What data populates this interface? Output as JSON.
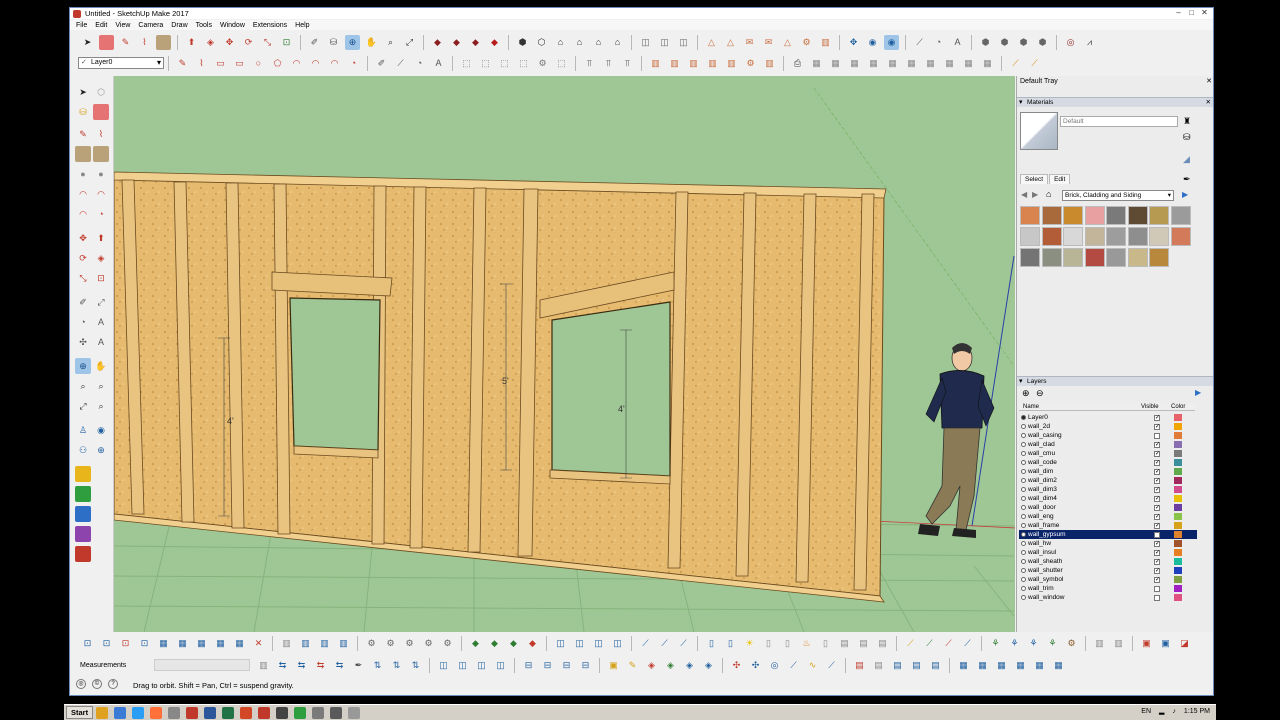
{
  "window": {
    "title": "Untitled - SketchUp Make 2017"
  },
  "window_controls": {
    "minimize": "–",
    "maximize": "□",
    "close": "✕"
  },
  "menu": [
    "File",
    "Edit",
    "View",
    "Camera",
    "Draw",
    "Tools",
    "Window",
    "Extensions",
    "Help"
  ],
  "layers_toolbar": {
    "current_layer": "Layer0"
  },
  "tray": {
    "title": "Default Tray",
    "materials": {
      "header": "Materials",
      "current_material": "Default",
      "tabs": [
        "Select",
        "Edit"
      ],
      "collection": "Brick, Cladding and Siding",
      "swatch_colors": [
        "#d9844e",
        "#a86a3a",
        "#c98a2e",
        "#e9a0a0",
        "#7a7a7a",
        "#5f4a34",
        "#b79a52",
        "#9b9b9b",
        "#c7c7c7",
        "#b35c38",
        "#d8d8d8",
        "#c2b59a",
        "#9d9d9d",
        "#8e8e8e",
        "#d1c9b8",
        "#d27a5a",
        "#747474",
        "#8b8f82",
        "#b8b496",
        "#b34b42",
        "#999999",
        "#c9b98a",
        "#b8893c"
      ]
    },
    "layers": {
      "header": "Layers",
      "columns": {
        "name": "Name",
        "visible": "Visible",
        "color": "Color"
      },
      "rows": [
        {
          "name": "Layer0",
          "active": true,
          "visible": true,
          "color": "#e8626a"
        },
        {
          "name": "wall_2d",
          "visible": true,
          "color": "#f0a500"
        },
        {
          "name": "wall_casing",
          "visible": false,
          "color": "#e07b39"
        },
        {
          "name": "wall_clad",
          "visible": true,
          "color": "#8a6fb0"
        },
        {
          "name": "wall_cmu",
          "visible": true,
          "color": "#7a7a7a"
        },
        {
          "name": "wall_code",
          "visible": true,
          "color": "#3a8f9a"
        },
        {
          "name": "wall_dim",
          "visible": true,
          "color": "#5fa84b"
        },
        {
          "name": "wall_dim2",
          "visible": true,
          "color": "#a1285c"
        },
        {
          "name": "wall_dim3",
          "visible": true,
          "color": "#d14c8a"
        },
        {
          "name": "wall_dim4",
          "visible": true,
          "color": "#e8c000"
        },
        {
          "name": "wall_door",
          "visible": true,
          "color": "#6b3fa0"
        },
        {
          "name": "wall_eng",
          "visible": true,
          "color": "#8bc34a"
        },
        {
          "name": "wall_frame",
          "visible": true,
          "color": "#d6a21a"
        },
        {
          "name": "wall_gypsum",
          "visible": false,
          "color": "#e0822d",
          "selected": true
        },
        {
          "name": "wall_hw",
          "visible": true,
          "color": "#a0522d"
        },
        {
          "name": "wall_insul",
          "visible": true,
          "color": "#e67e22"
        },
        {
          "name": "wall_sheath",
          "visible": true,
          "color": "#1abc9c"
        },
        {
          "name": "wall_shutter",
          "visible": true,
          "color": "#1f3fbf"
        },
        {
          "name": "wall_symbol",
          "visible": true,
          "color": "#7fa040"
        },
        {
          "name": "wall_trim",
          "visible": false,
          "color": "#a020c0"
        },
        {
          "name": "wall_window",
          "visible": false,
          "color": "#e05080"
        }
      ]
    }
  },
  "viewport": {
    "dimension_labels": [
      "4'",
      "5'",
      "4'"
    ]
  },
  "status": {
    "measurements_label": "Measurements",
    "hint": "Drag to orbit. Shift = Pan, Ctrl = suspend gravity."
  },
  "taskbar": {
    "start": "Start",
    "language": "EN",
    "clock": "1:15 PM"
  }
}
